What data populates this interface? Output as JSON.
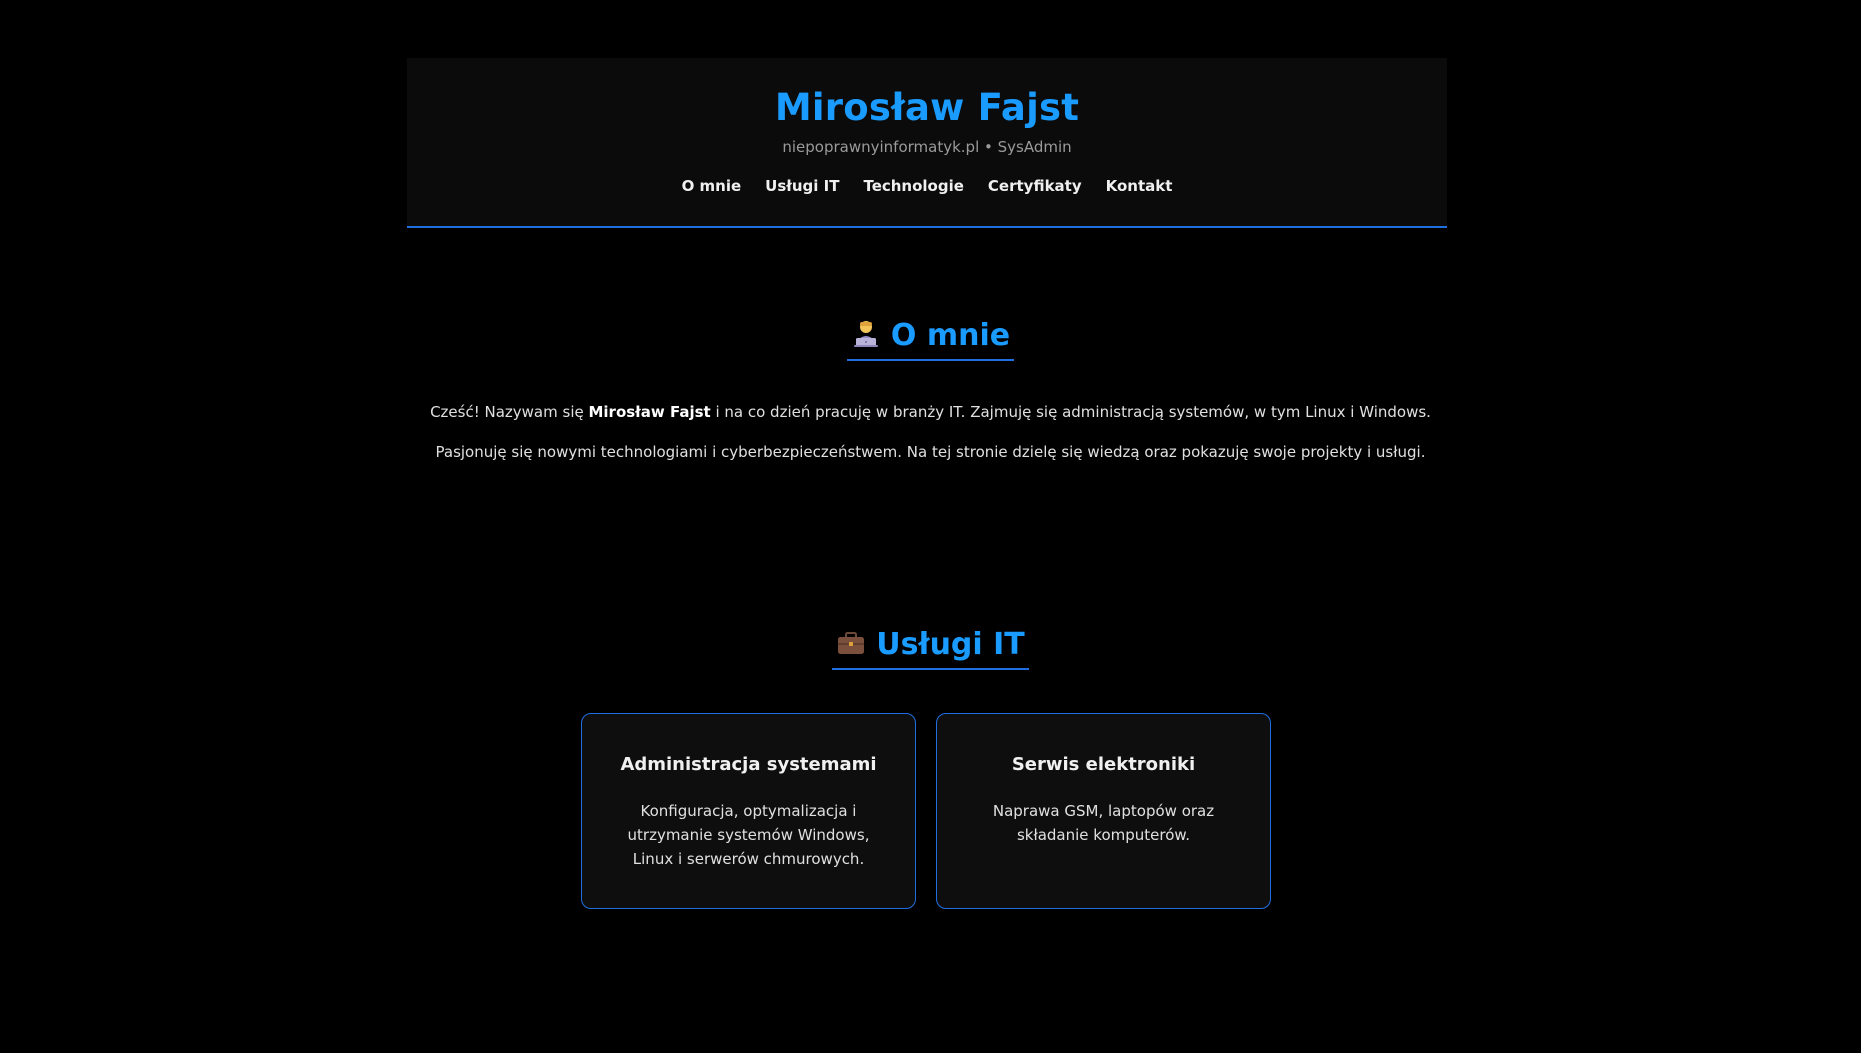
{
  "header": {
    "title": "Mirosław Fajst",
    "subtitle": "niepoprawnyinformatyk.pl • SysAdmin",
    "nav": [
      {
        "label": "O mnie"
      },
      {
        "label": "Usługi IT"
      },
      {
        "label": "Technologie"
      },
      {
        "label": "Certyfikaty"
      },
      {
        "label": "Kontakt"
      }
    ]
  },
  "about": {
    "icon": "technologist-icon",
    "heading": "O mnie",
    "line1_before": "Cześć! Nazywam się ",
    "line1_name": "Mirosław Fajst",
    "line1_after": " i na co dzień pracuję w branży IT. Zajmuję się administracją systemów, w tym Linux i Windows.",
    "line2": "Pasjonuję się nowymi technologiami i cyberbezpieczeństwem. Na tej stronie dzielę się wiedzą oraz pokazuję swoje projekty i usługi."
  },
  "services": {
    "icon": "briefcase-icon",
    "heading": "Usługi IT",
    "cards": [
      {
        "title": "Administracja systemami",
        "text": "Konfiguracja, optymalizacja i utrzymanie systemów Windows, Linux i serwerów chmurowych."
      },
      {
        "title": "Serwis elektroniki",
        "text": "Naprawa GSM, laptopów oraz składanie komputerów."
      }
    ]
  },
  "colors": {
    "accent": "#1a9bff",
    "border": "#1f6fe0",
    "background": "#000000",
    "panel": "#0b0b0b"
  }
}
